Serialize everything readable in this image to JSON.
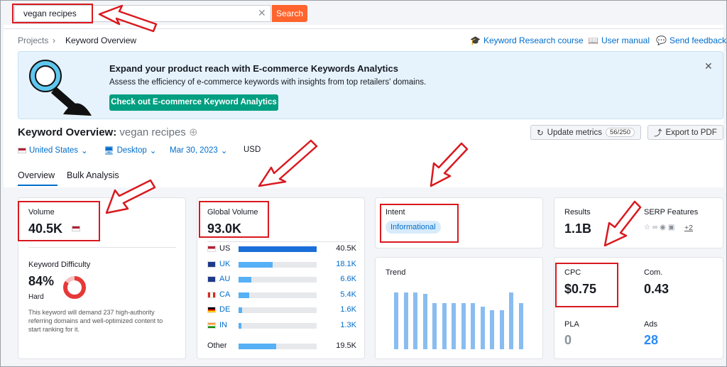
{
  "search": {
    "value": "vegan recipes",
    "button": "Search"
  },
  "breadcrumb": {
    "root": "Projects",
    "current": "Keyword Overview"
  },
  "links": {
    "course": "Keyword Research course",
    "manual": "User manual",
    "feedback": "Send feedback"
  },
  "banner": {
    "title": "Expand your product reach with E-commerce Keywords Analytics",
    "subtitle": "Assess the efficiency of e-commerce keywords with insights from top retailers' domains.",
    "button": "Check out E-commerce Keyword Analytics"
  },
  "page": {
    "title": "Keyword Overview:",
    "keyword": "vegan recipes"
  },
  "actions": {
    "update": "Update metrics",
    "update_count": "56/250",
    "export": "Export to PDF"
  },
  "filters": {
    "country": "United States",
    "device": "Desktop",
    "date": "Mar 30, 2023",
    "currency": "USD"
  },
  "tabs": {
    "overview": "Overview",
    "bulk": "Bulk Analysis"
  },
  "volume": {
    "label": "Volume",
    "value": "40.5K"
  },
  "difficulty": {
    "label": "Keyword Difficulty",
    "value": "84%",
    "level": "Hard",
    "percent": 84,
    "note": "This keyword will demand 237 high-authority referring domains and well-optimized content to start ranking for it."
  },
  "global": {
    "label": "Global Volume",
    "value": "93.0K",
    "countries": [
      {
        "code": "US",
        "value": "40.5K",
        "share": 0.44
      },
      {
        "code": "UK",
        "value": "18.1K",
        "share": 0.19
      },
      {
        "code": "AU",
        "value": "6.6K",
        "share": 0.07
      },
      {
        "code": "CA",
        "value": "5.4K",
        "share": 0.06
      },
      {
        "code": "DE",
        "value": "1.6K",
        "share": 0.02
      },
      {
        "code": "IN",
        "value": "1.3K",
        "share": 0.015
      }
    ],
    "other": {
      "code": "Other",
      "value": "19.5K",
      "share": 0.21
    }
  },
  "intent": {
    "label": "Intent",
    "value": "Informational"
  },
  "trend": {
    "label": "Trend",
    "values": [
      0.8,
      0.8,
      0.8,
      0.78,
      0.65,
      0.65,
      0.65,
      0.65,
      0.65,
      0.6,
      0.55,
      0.55,
      0.8,
      0.65
    ]
  },
  "results": {
    "label": "Results",
    "value": "1.1B"
  },
  "serp": {
    "label": "SERP Features",
    "more": "+2"
  },
  "cpc": {
    "label": "CPC",
    "value": "$0.75"
  },
  "com": {
    "label": "Com.",
    "value": "0.43"
  },
  "pla": {
    "label": "PLA",
    "value": "0"
  },
  "ads": {
    "label": "Ads",
    "value": "28"
  },
  "colors": {
    "accent": "#006dca",
    "orange": "#ff642d",
    "green": "#009f81",
    "red": "#d9191e",
    "bar": "#2b8cf7"
  }
}
